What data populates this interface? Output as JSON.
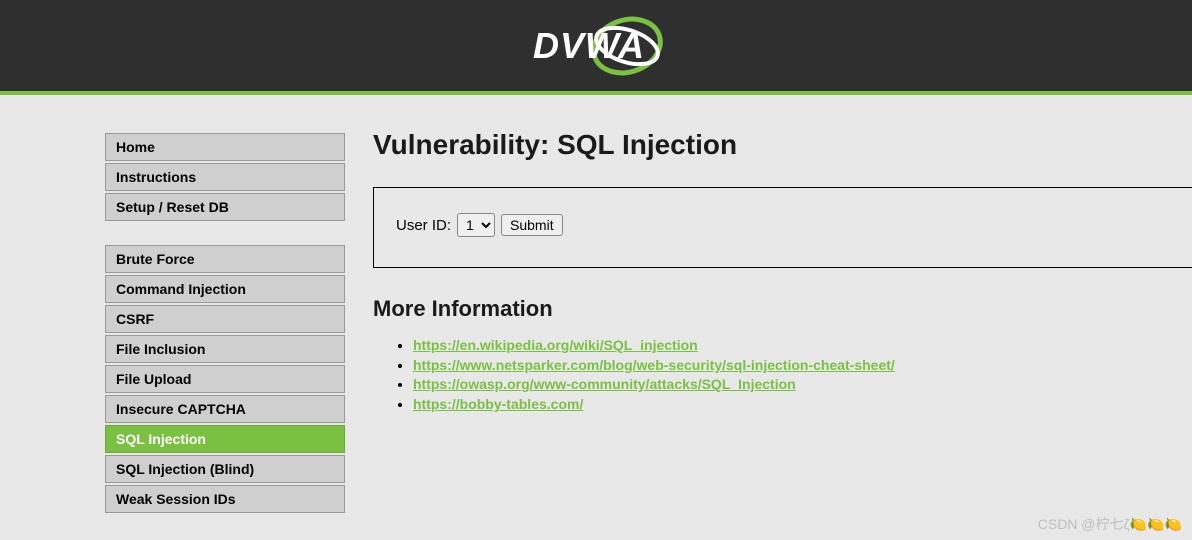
{
  "header": {
    "logo_text": "DVWA"
  },
  "sidebar": {
    "group1": [
      {
        "label": "Home",
        "name": "sidebar-item-home"
      },
      {
        "label": "Instructions",
        "name": "sidebar-item-instructions"
      },
      {
        "label": "Setup / Reset DB",
        "name": "sidebar-item-setup-reset-db"
      }
    ],
    "group2": [
      {
        "label": "Brute Force",
        "name": "sidebar-item-brute-force"
      },
      {
        "label": "Command Injection",
        "name": "sidebar-item-command-injection"
      },
      {
        "label": "CSRF",
        "name": "sidebar-item-csrf"
      },
      {
        "label": "File Inclusion",
        "name": "sidebar-item-file-inclusion"
      },
      {
        "label": "File Upload",
        "name": "sidebar-item-file-upload"
      },
      {
        "label": "Insecure CAPTCHA",
        "name": "sidebar-item-insecure-captcha"
      },
      {
        "label": "SQL Injection",
        "name": "sidebar-item-sql-injection",
        "active": true
      },
      {
        "label": "SQL Injection (Blind)",
        "name": "sidebar-item-sql-injection-blind"
      },
      {
        "label": "Weak Session IDs",
        "name": "sidebar-item-weak-session-ids"
      }
    ]
  },
  "main": {
    "title": "Vulnerability: SQL Injection",
    "user_id_label": "User ID:",
    "user_id_value": "1",
    "submit_label": "Submit",
    "more_info_heading": "More Information",
    "links": [
      "https://en.wikipedia.org/wiki/SQL_injection",
      "https://www.netsparker.com/blog/web-security/sql-injection-cheat-sheet/",
      "https://owasp.org/www-community/attacks/SQL_Injection",
      "https://bobby-tables.com/"
    ]
  },
  "watermark": "CSDN @柠七ζ🍋🍋🍋"
}
